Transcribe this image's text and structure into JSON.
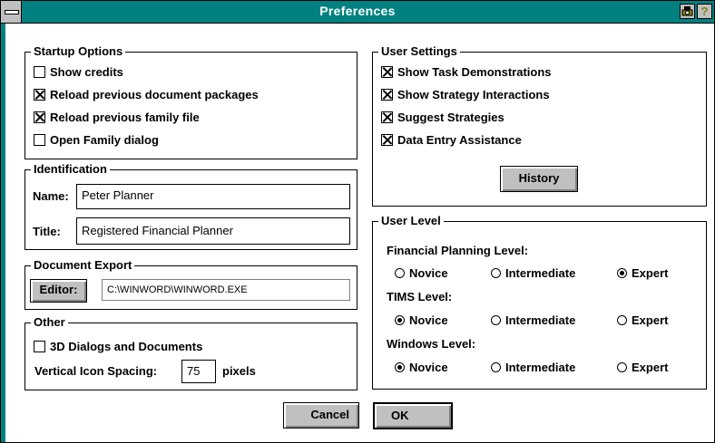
{
  "window": {
    "title": "Preferences",
    "camera_icon": "camera-icon",
    "help_icon": "help-icon",
    "help_glyph": "?"
  },
  "startup_options": {
    "title": "Startup Options",
    "items": [
      {
        "label": "Show credits",
        "checked": false
      },
      {
        "label": "Reload previous document packages",
        "checked": true
      },
      {
        "label": "Reload previous family file",
        "checked": true
      },
      {
        "label": "Open Family dialog",
        "checked": false
      }
    ]
  },
  "identification": {
    "title": "Identification",
    "name_label": "Name:",
    "name_value": "Peter Planner",
    "title_label": "Title:",
    "title_value": "Registered Financial Planner"
  },
  "document_export": {
    "title": "Document Export",
    "editor_button": "Editor:",
    "editor_path": "C:\\WINWORD\\WINWORD.EXE"
  },
  "other": {
    "title": "Other",
    "dialogs_3d_label": "3D Dialogs and Documents",
    "dialogs_3d_checked": false,
    "spacing_label": "Vertical Icon Spacing:",
    "spacing_value": "75",
    "spacing_unit": "pixels"
  },
  "user_settings": {
    "title": "User Settings",
    "items": [
      {
        "label": "Show Task Demonstrations",
        "checked": true
      },
      {
        "label": "Show Strategy Interactions",
        "checked": true
      },
      {
        "label": "Suggest Strategies",
        "checked": true
      },
      {
        "label": "Data Entry Assistance",
        "checked": true
      }
    ],
    "history_button": "History"
  },
  "user_level": {
    "title": "User Level",
    "groups": [
      {
        "label": "Financial Planning Level:",
        "options": [
          "Novice",
          "Intermediate",
          "Expert"
        ],
        "selected": "Expert"
      },
      {
        "label": "TIMS Level:",
        "options": [
          "Novice",
          "Intermediate",
          "Expert"
        ],
        "selected": "Novice"
      },
      {
        "label": "Windows Level:",
        "options": [
          "Novice",
          "Intermediate",
          "Expert"
        ],
        "selected": "Novice"
      }
    ]
  },
  "buttons": {
    "cancel": "Cancel",
    "ok": "OK"
  },
  "colors": {
    "title_bar": "#008080",
    "button_face": "#c0c0c0"
  }
}
